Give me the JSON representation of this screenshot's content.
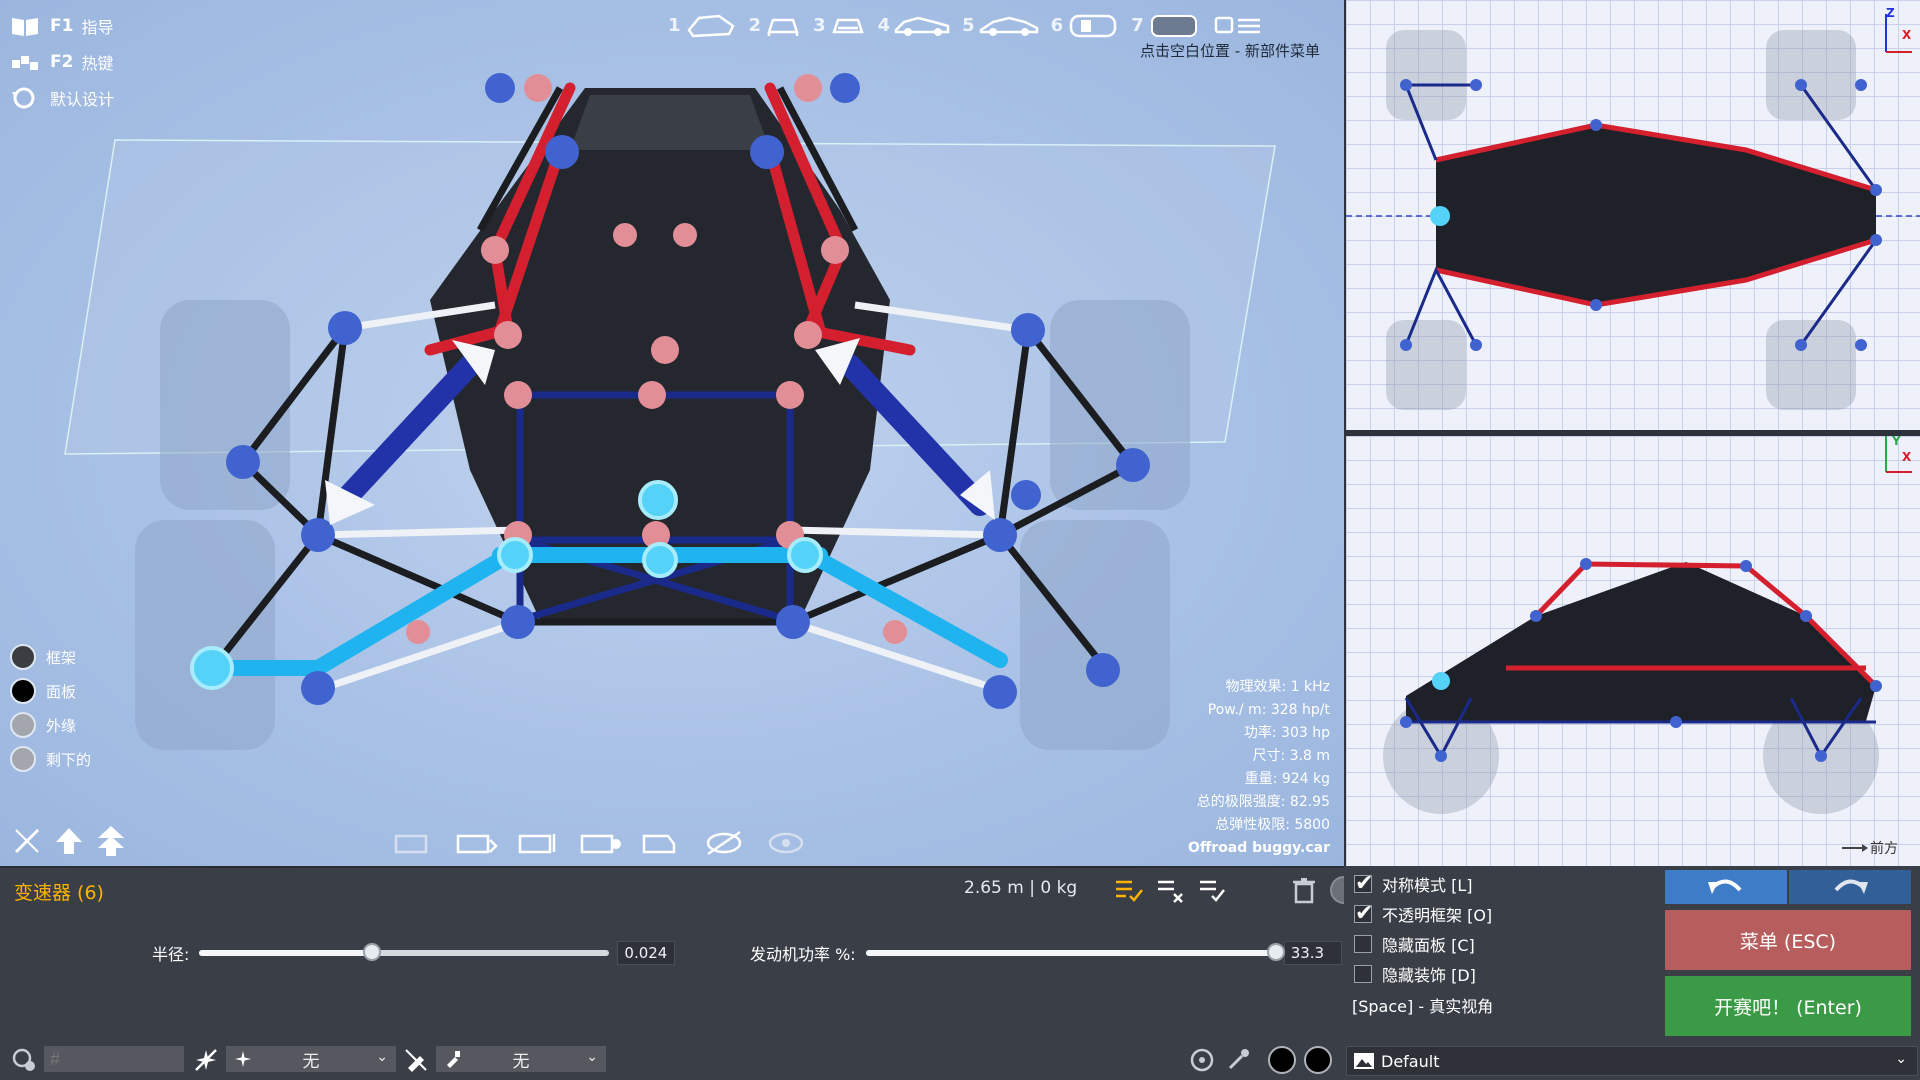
{
  "top_left_menu": [
    {
      "key": "F1",
      "label": "指导",
      "icon": "book-icon"
    },
    {
      "key": "F2",
      "label": "热键",
      "icon": "hotkeys-icon"
    },
    {
      "key": "",
      "label": "默认设计",
      "icon": "reset-icon"
    }
  ],
  "presets": [
    {
      "num": "1",
      "icon": "car-3d-icon"
    },
    {
      "num": "2",
      "icon": "car-front-icon"
    },
    {
      "num": "3",
      "icon": "car-rear-icon"
    },
    {
      "num": "4",
      "icon": "car-side-icon"
    },
    {
      "num": "5",
      "icon": "car-side-long-icon"
    },
    {
      "num": "6",
      "icon": "car-top-icon"
    },
    {
      "num": "7",
      "icon": "car-bottom-icon"
    }
  ],
  "new_part_hint": "点击空白位置 - 新部件菜单",
  "legend": [
    {
      "label": "框架",
      "color": "#3a3d42"
    },
    {
      "label": "面板",
      "color": "#000000"
    },
    {
      "label": "外缘",
      "color": "#a3a7ad"
    },
    {
      "label": "剩下的",
      "color": "#a3a7ad"
    }
  ],
  "stats": {
    "physics": "物理效果: 1 kHz",
    "pow_mass": "Pow./ m: 328 hp/t",
    "power": "功率: 303 hp",
    "size": "尺寸: 3.8 m",
    "weight": "重量: 924 kg",
    "ultimate_strength": "总的极限强度: 82.95",
    "elastic_limit": "总弹性极限: 5800",
    "file": "Offroad buggy.car"
  },
  "part": {
    "title": "变速器 (6)",
    "metrics": "2.65 m  |  0 kg",
    "radius_label": "半径:",
    "radius_value": "0.024",
    "radius_fraction": 0.42,
    "engine_label": "发动机功率 %:",
    "engine_value": "33.3",
    "engine_fraction": 1.0
  },
  "bottom_bar": {
    "hash_placeholder": "#",
    "dropdown1_value": "无",
    "dropdown2_value": "无"
  },
  "options": {
    "symmetry": "对称模式 [L]",
    "opaque_frame": "不透明框架 [O]",
    "hide_panels": "隐藏面板 [C]",
    "hide_decor": "隐藏装饰 [D]",
    "space_hint": "[Space] - 真实视角",
    "symmetry_checked": true,
    "opaque_checked": true,
    "hide_panels_checked": false,
    "hide_decor_checked": false
  },
  "buttons": {
    "menu": "菜单 (ESC)",
    "race": "开赛吧！ (Enter)"
  },
  "views": {
    "front_label": "前方",
    "top_axis_a": "Z",
    "top_axis_b": "X",
    "side_axis_a": "Y",
    "side_axis_b": "X"
  },
  "default_dropdown": "Default",
  "colors": {
    "accent_blue": "#3f7cc8",
    "menu_red": "#b75d5d",
    "race_green": "#3b9a45",
    "part_title": "#ffb300"
  }
}
